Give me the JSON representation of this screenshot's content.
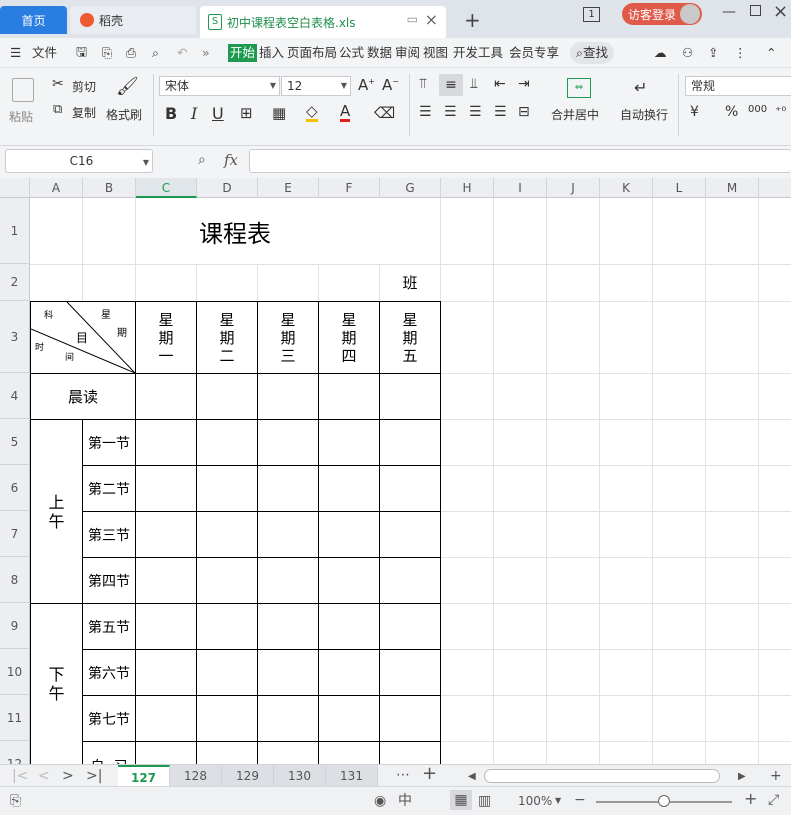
{
  "tabs": {
    "home": "首页",
    "daoke": "稻壳",
    "file": "初中课程表空白表格.xls",
    "window_count": "1",
    "login": "访客登录"
  },
  "menu": {
    "file": "文件",
    "items": [
      "开始",
      "插入",
      "页面布局",
      "公式",
      "数据",
      "审阅",
      "视图",
      "开发工具",
      "会员专享"
    ],
    "search": "查找"
  },
  "ribbon": {
    "paste": "粘贴",
    "cut": "剪切",
    "copy": "复制",
    "format_painter": "格式刷",
    "font_name": "宋体",
    "font_size": "12",
    "merge_center": "合并居中",
    "wrap_text": "自动换行",
    "number_format": "常规",
    "currency": "¥",
    "percent": "%",
    "thousands": "000"
  },
  "formula_bar": {
    "name_box": "C16",
    "fx": "fx",
    "value": ""
  },
  "columns": [
    "A",
    "B",
    "C",
    "D",
    "E",
    "F",
    "G",
    "H",
    "I",
    "J",
    "K",
    "L",
    "M"
  ],
  "rows": [
    "1",
    "2",
    "3",
    "4",
    "5",
    "6",
    "7",
    "8",
    "9",
    "10",
    "11",
    "12"
  ],
  "timetable": {
    "title": "课程表",
    "class_label": "班",
    "diag_labels": {
      "ke": "科",
      "xing": "星",
      "mu": "目",
      "qi": "期",
      "shi": "时",
      "jian": "间"
    },
    "days": [
      "星\n期\n一",
      "星\n期\n二",
      "星\n期\n三",
      "星\n期\n四",
      "星\n期\n五"
    ],
    "morning_read": "晨读",
    "morning": "上\n午",
    "afternoon": "下\n午",
    "periods": [
      "第一节",
      "第二节",
      "第三节",
      "第四节",
      "第五节",
      "第六节",
      "第七节"
    ],
    "self_study": "自  习"
  },
  "sheets": [
    "127",
    "128",
    "129",
    "130",
    "131"
  ],
  "status": {
    "zoom": "100%"
  }
}
